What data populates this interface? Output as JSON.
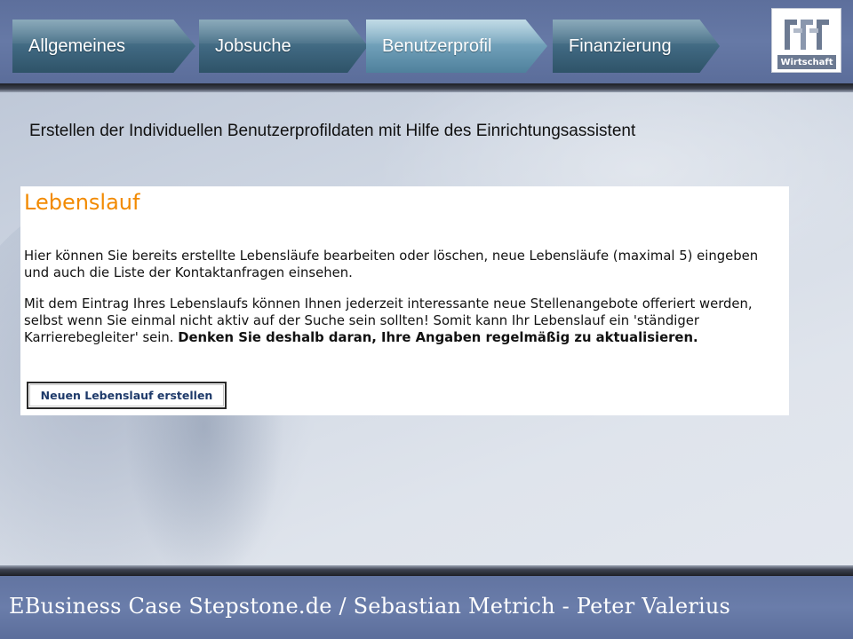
{
  "nav": {
    "tabs": [
      {
        "label": "Allgemeines",
        "active": false
      },
      {
        "label": "Jobsuche",
        "active": false
      },
      {
        "label": "Benutzerprofil",
        "active": true
      },
      {
        "label": "Finanzierung",
        "active": false
      }
    ]
  },
  "logo": {
    "text": "Wirtschaft",
    "color": "#6c7a92"
  },
  "heading": "Erstellen der Individuellen Benutzerprofildaten mit Hilfe des Einrichtungsassistent",
  "panel": {
    "title": "Lebenslauf",
    "title_color": "#f28a00",
    "paragraph1": "Hier können Sie bereits erstellte Lebensläufe bearbeiten oder löschen, neue Lebensläufe (maximal 5) eingeben und auch die Liste der Kontaktanfragen einsehen.",
    "paragraph2_normal": "Mit dem Eintrag Ihres Lebenslaufs können Ihnen jederzeit interessante neue Stellenangebote offeriert werden, selbst wenn Sie einmal nicht aktiv auf der Suche sein sollten! Somit kann Ihr Lebenslauf ein 'ständiger Karrierebegleiter' sein. ",
    "paragraph2_bold": "Denken Sie deshalb daran, Ihre Angaben regelmäßig zu aktualisieren.",
    "button_label": "Neuen Lebenslauf erstellen"
  },
  "footer": {
    "text": "EBusiness Case Stepstone.de  /  Sebastian Metrich - Peter Valerius"
  },
  "colors": {
    "header_bg": "#6679a6",
    "tab_bg": "#3f6780",
    "tab_active_bg": "#6f9fb8"
  }
}
